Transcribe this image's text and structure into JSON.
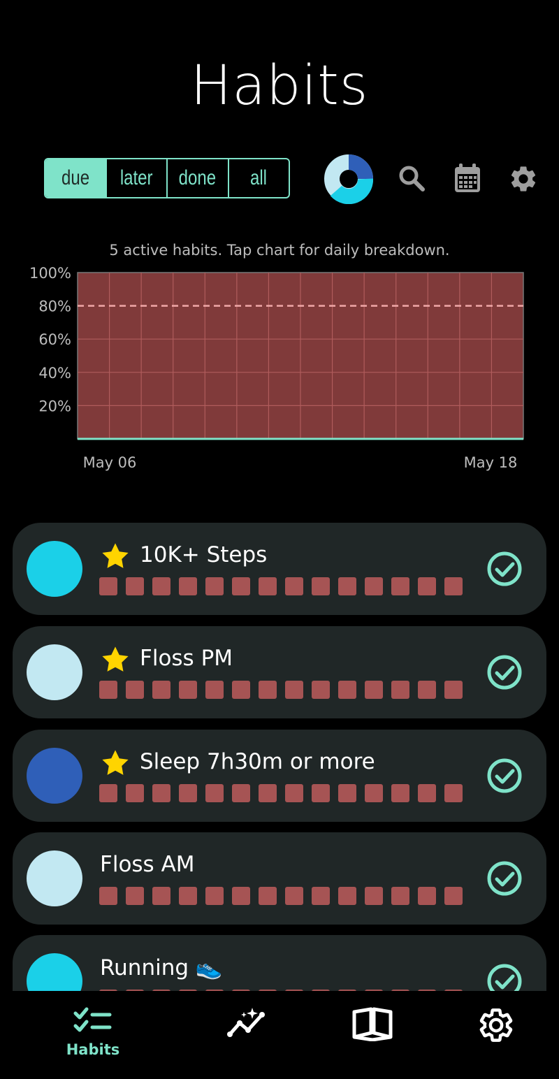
{
  "header": {
    "title": "Habits"
  },
  "filters": [
    {
      "label": "due",
      "active": true
    },
    {
      "label": "later",
      "active": false
    },
    {
      "label": "done",
      "active": false
    },
    {
      "label": "all",
      "active": false
    }
  ],
  "toolbar_icons": [
    "donut-chart-icon",
    "search-icon",
    "calendar-icon",
    "settings-icon"
  ],
  "summary_text": "5 active habits. Tap chart for daily breakdown.",
  "chart_data": {
    "type": "area",
    "y_tick_labels": [
      "100%",
      "80%",
      "60%",
      "40%",
      "20%"
    ],
    "x_tick_labels": [
      "May 06",
      "May 18"
    ],
    "ylim": [
      0,
      100
    ],
    "x": [
      "May 06",
      "May 07",
      "May 08",
      "May 09",
      "May 10",
      "May 11",
      "May 12",
      "May 13",
      "May 14",
      "May 15",
      "May 16",
      "May 17",
      "May 18"
    ],
    "values": [
      0,
      0,
      0,
      0,
      0,
      0,
      0,
      0,
      0,
      0,
      0,
      0,
      0
    ],
    "target_line": 80,
    "grid": true,
    "colors": {
      "fill": "#803a3a",
      "grid": "#b05c5c",
      "target": "#f0a8a8",
      "line": "#7fe3c9"
    }
  },
  "habits": [
    {
      "name": "10K+ Steps",
      "starred": true,
      "color": "#1bd0e8",
      "days": 14
    },
    {
      "name": "Floss PM",
      "starred": true,
      "color": "#c2e8f2",
      "days": 14
    },
    {
      "name": "Sleep 7h30m or more",
      "starred": true,
      "color": "#2f5fb8",
      "days": 14
    },
    {
      "name": "Floss AM",
      "starred": false,
      "color": "#c2e8f2",
      "days": 14
    },
    {
      "name": "Running 👟",
      "starred": false,
      "color": "#1bd0e8",
      "days": 14
    }
  ],
  "nav": [
    {
      "label": "Habits",
      "icon": "checklist-icon",
      "active": true
    },
    {
      "label": "",
      "icon": "insights-icon",
      "active": false
    },
    {
      "label": "",
      "icon": "book-icon",
      "active": false
    },
    {
      "label": "",
      "icon": "settings-icon",
      "active": false
    }
  ],
  "colors": {
    "accent": "#7fe3c9",
    "card": "#202727",
    "missed": "#a65454",
    "star": "#ffd400"
  }
}
